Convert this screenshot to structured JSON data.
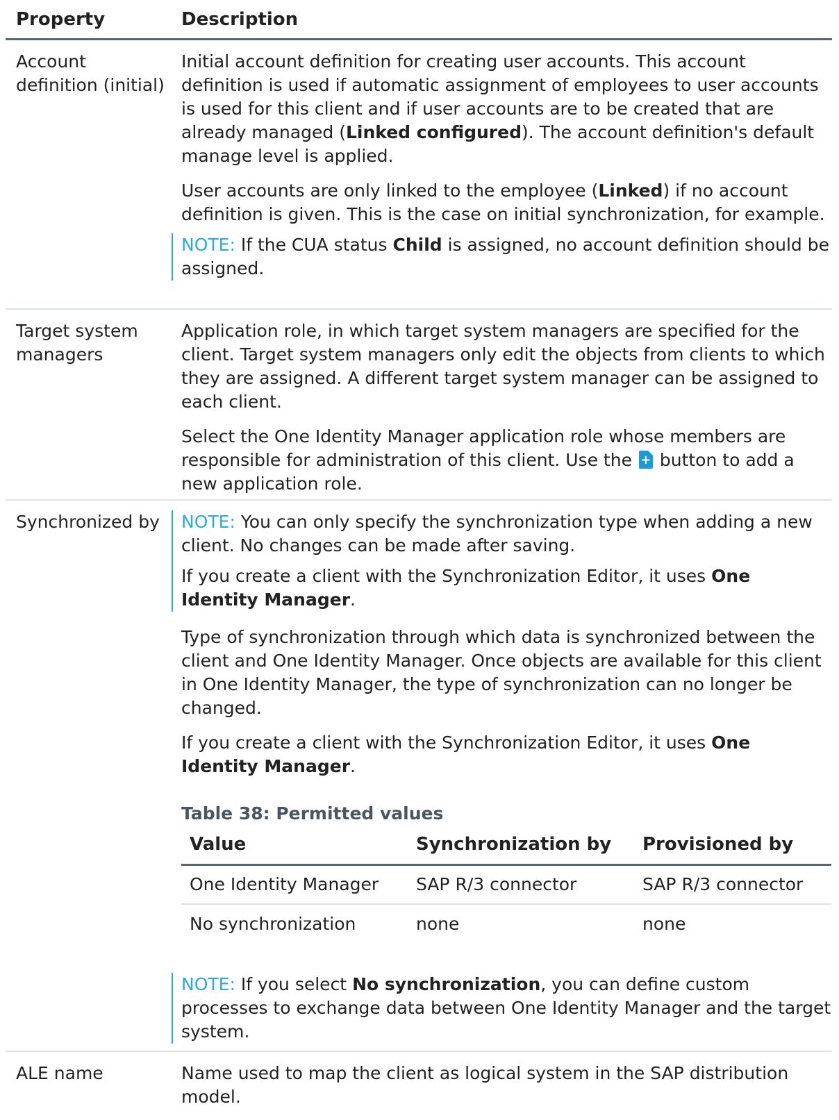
{
  "header": {
    "property": "Property",
    "description": "Description"
  },
  "rows": [
    {
      "property": "Account definition (initial)",
      "p1_a": "Initial account definition for creating user accounts. This account definition is used if automatic assignment of employees to user accounts is used for this client and if user accounts are to be created that are already managed (",
      "p1_b": "Linked configured",
      "p1_c": "). The account definition's default manage level is applied.",
      "p2_a": "User accounts are only linked to the employee (",
      "p2_b": "Linked",
      "p2_c": ") if no account definition is given. This is the case on initial synchronization, for example.",
      "note_label": "NOTE:",
      "note_a": " If the CUA status ",
      "note_b": "Child",
      "note_c": " is assigned, no account definition should be assigned."
    },
    {
      "property": "Target system managers",
      "p1": "Application role, in which target system managers are specified for the client. Target system managers only edit the objects from clients to which they are assigned. A different target system manager can be assigned to each client.",
      "p2_a": "Select the One Identity Manager application role whose members are responsible for administration of this client. Use the ",
      "p2_icon": "add-document-icon",
      "p2_b": " button to add a new application role."
    },
    {
      "property": "Synchronized by",
      "note1_label": "NOTE:",
      "note1_a": " You can only specify the synchronization type when adding a new client. No changes can be made after saving.",
      "note1_b": "If you create a client with the Synchronization Editor, it uses ",
      "note1_c": "One Identity Manager",
      "note1_d": ".",
      "p1": "Type of synchronization through which data is synchronized between the client and One Identity Manager. Once objects are available for this client in One Identity Manager, the type of synchronization can no longer be changed.",
      "p2_a": "If you create a client with the Synchronization Editor, it uses ",
      "p2_b": "One Identity Manager",
      "p2_c": ".",
      "table_caption": "Table 38: Permitted values",
      "table_headers": [
        "Value",
        "Synchronization by",
        "Provisioned by"
      ],
      "table_rows": [
        [
          "One Identity Manager",
          "SAP R/3 connector",
          "SAP R/3 connector"
        ],
        [
          "No synchronization",
          "none",
          "none"
        ]
      ],
      "note2_label": "NOTE:",
      "note2_a": " If you select ",
      "note2_b": "No synchronization",
      "note2_c": ", you can define custom processes to exchange data between One Identity Manager and the target system."
    },
    {
      "property": "ALE name",
      "p1": "Name used to map the client as logical system in the SAP distribution model."
    }
  ],
  "colors": {
    "note_accent": "#2ba9e0",
    "header_rule": "#5a666d",
    "row_rule": "#dde2e5",
    "icon_blue": "#1a9ad6"
  }
}
